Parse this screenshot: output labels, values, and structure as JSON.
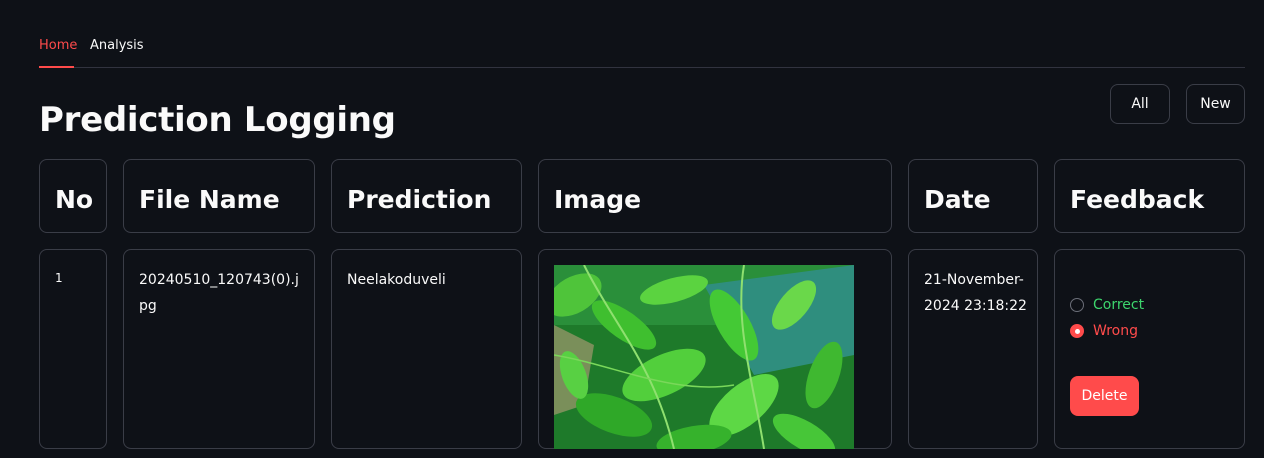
{
  "tabs": [
    {
      "label": "Home",
      "active": true
    },
    {
      "label": "Analysis",
      "active": false
    }
  ],
  "page_title": "Prediction Logging",
  "filter_buttons": {
    "all_label": "All",
    "new_label": "New"
  },
  "table": {
    "headers": [
      "No",
      "File Name",
      "Prediction",
      "Image",
      "Date",
      "Feedback"
    ],
    "rows": [
      {
        "no": "1",
        "file_name": "20240510_120743(0).jpg",
        "prediction": "Neelakoduveli",
        "date": "21-November-2024 23:18:22",
        "feedback": {
          "options": [
            "Correct",
            "Wrong"
          ],
          "selected": "Wrong"
        },
        "delete_label": "Delete"
      }
    ]
  },
  "colors": {
    "background": "#0e1117",
    "accent": "#ff4b4b",
    "correct": "#3dd56d",
    "border": "#3a3d47"
  }
}
